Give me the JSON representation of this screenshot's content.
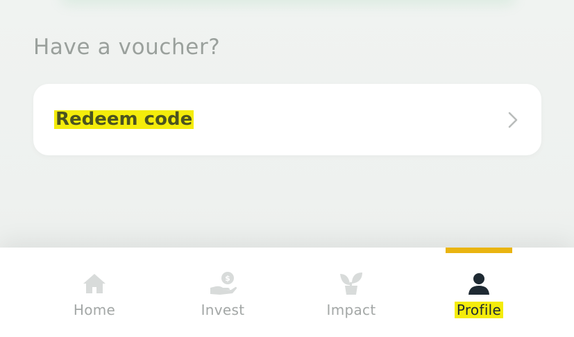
{
  "voucher": {
    "title": "Have a voucher?",
    "redeem_label": "Redeem code"
  },
  "tabbar": {
    "tabs": [
      {
        "label": "Home",
        "icon": "home-icon"
      },
      {
        "label": "Invest",
        "icon": "hand-coin-icon"
      },
      {
        "label": "Impact",
        "icon": "plant-icon"
      },
      {
        "label": "Profile",
        "icon": "person-icon"
      }
    ],
    "active": "Profile"
  },
  "colors": {
    "accent_bar": "#e9b411",
    "highlight": "#f4ec0b",
    "inactive_icon": "#d8dbda",
    "active_icon": "#1f2a33"
  }
}
